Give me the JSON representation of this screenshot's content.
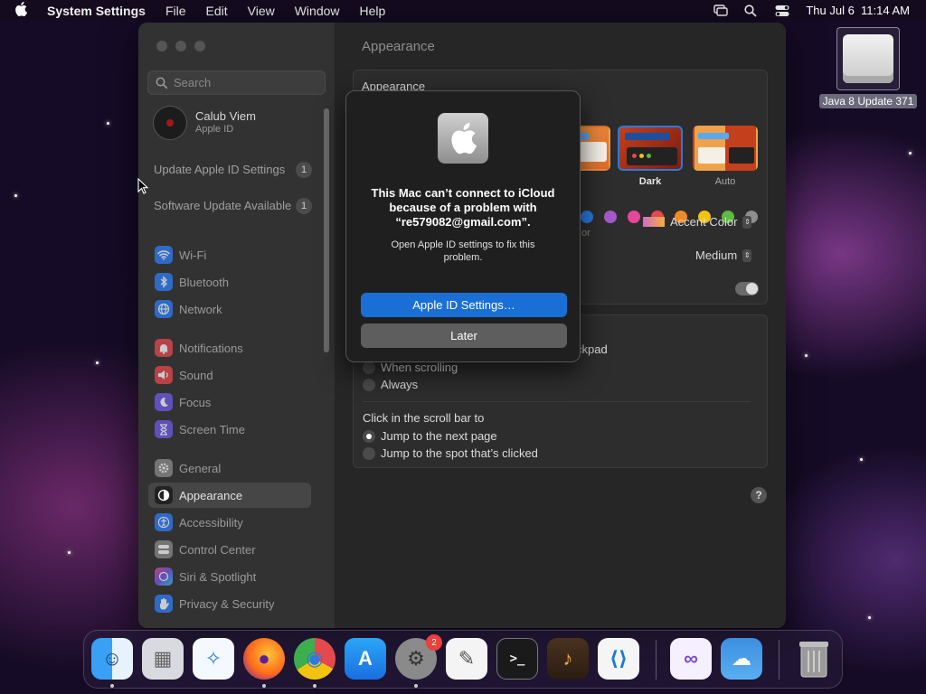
{
  "menubar": {
    "app_name": "System Settings",
    "items": [
      "File",
      "Edit",
      "View",
      "Window",
      "Help"
    ],
    "clock": "Thu Jul 6  11:14 AM"
  },
  "desktop": {
    "drive_label": "Java 8 Update 371"
  },
  "sidebar": {
    "search_placeholder": "Search",
    "account": {
      "name": "Calub Viem",
      "subtitle": "Apple ID"
    },
    "notices": [
      {
        "label": "Update Apple ID Settings",
        "count": "1"
      },
      {
        "label": "Software Update Available",
        "count": "1"
      }
    ],
    "items": [
      {
        "label": "Wi-Fi",
        "icon": "wifi-icon",
        "color": "#2d7ff9"
      },
      {
        "label": "Bluetooth",
        "icon": "bluetooth-icon",
        "color": "#2d7ff9"
      },
      {
        "label": "Network",
        "icon": "globe-icon",
        "color": "#2d7ff9"
      },
      {
        "label": "Notifications",
        "icon": "bell-icon",
        "color": "#e5484d"
      },
      {
        "label": "Sound",
        "icon": "speaker-icon",
        "color": "#e5484d"
      },
      {
        "label": "Focus",
        "icon": "moon-icon",
        "color": "#6e5ae8"
      },
      {
        "label": "Screen Time",
        "icon": "hourglass-icon",
        "color": "#6e5ae8"
      },
      {
        "label": "General",
        "icon": "gear-icon",
        "color": "#8a8a8a"
      },
      {
        "label": "Appearance",
        "icon": "appearance-icon",
        "color": "#222222"
      },
      {
        "label": "Accessibility",
        "icon": "accessibility-icon",
        "color": "#2d7ff9"
      },
      {
        "label": "Control Center",
        "icon": "control-center-icon",
        "color": "#8a8a8a"
      },
      {
        "label": "Siri & Spotlight",
        "icon": "siri-icon",
        "color": "#b04fd8"
      },
      {
        "label": "Privacy & Security",
        "icon": "hand-icon",
        "color": "#2d7ff9"
      }
    ],
    "selected": "Appearance"
  },
  "content": {
    "title": "Appearance",
    "appearance_label": "Appearance",
    "themes": [
      {
        "label": "nt",
        "selected": false
      },
      {
        "label": "Dark",
        "selected": true
      },
      {
        "label": "Auto",
        "selected": false
      }
    ],
    "accent_partial": "or",
    "accent_colors": [
      "#2a7ae2",
      "#a35ac8",
      "#e5489b",
      "#e5484d",
      "#f08a24",
      "#f2c40f",
      "#5dbb3f",
      "#8e8e8e"
    ],
    "highlight_value": "Accent Color",
    "sidebar_icon_size_value": "Medium",
    "scroll_partial": "ckpad",
    "scroll_options": [
      {
        "label": "When scrolling",
        "on": false
      },
      {
        "label": "Always",
        "on": false
      }
    ],
    "click_label": "Click in the scroll bar to",
    "click_options": [
      {
        "label": "Jump to the next page",
        "on": true
      },
      {
        "label": "Jump to the spot that’s clicked",
        "on": false
      }
    ],
    "help": "?"
  },
  "alert": {
    "title": "This Mac can’t connect to iCloud because of a problem with “re579082@gmail.com”.",
    "message": "Open Apple ID settings to fix this problem.",
    "primary_button": "Apple ID Settings…",
    "secondary_button": "Later"
  },
  "dock": {
    "apps": [
      {
        "name": "finder",
        "color": "#3d8ef2",
        "glyph": "☺",
        "running": true
      },
      {
        "name": "launchpad",
        "color": "#d9d9e0",
        "glyph": "▦",
        "running": false
      },
      {
        "name": "safari",
        "color": "#e8f0fa",
        "glyph": "✧",
        "running": false
      },
      {
        "name": "firefox",
        "color": "#ff7a1a",
        "glyph": "●",
        "running": true
      },
      {
        "name": "chrome",
        "color": "#f2f2f2",
        "glyph": "◉",
        "running": true
      },
      {
        "name": "app-store",
        "color": "#1d8df2",
        "glyph": "A",
        "running": false
      },
      {
        "name": "system-settings",
        "color": "#8a8a8a",
        "glyph": "⚙",
        "running": true,
        "badge": "2"
      },
      {
        "name": "textedit",
        "color": "#f4f4f4",
        "glyph": "✎",
        "running": false
      },
      {
        "name": "terminal",
        "color": "#1a1a1a",
        "glyph": ">_",
        "running": false
      },
      {
        "name": "garageband",
        "color": "#3a2a1a",
        "glyph": "♪",
        "running": false
      },
      {
        "name": "vscode",
        "color": "#f5f5f5",
        "glyph": "⟨⟩",
        "running": false
      },
      {
        "name": "visual-studio",
        "color": "#f5f0ff",
        "glyph": "∞",
        "running": false
      },
      {
        "name": "weather",
        "color": "#3b8fe0",
        "glyph": "☁",
        "running": false
      },
      {
        "name": "trash",
        "color": "#9a9a9a",
        "glyph": "🗑",
        "running": false
      }
    ]
  }
}
